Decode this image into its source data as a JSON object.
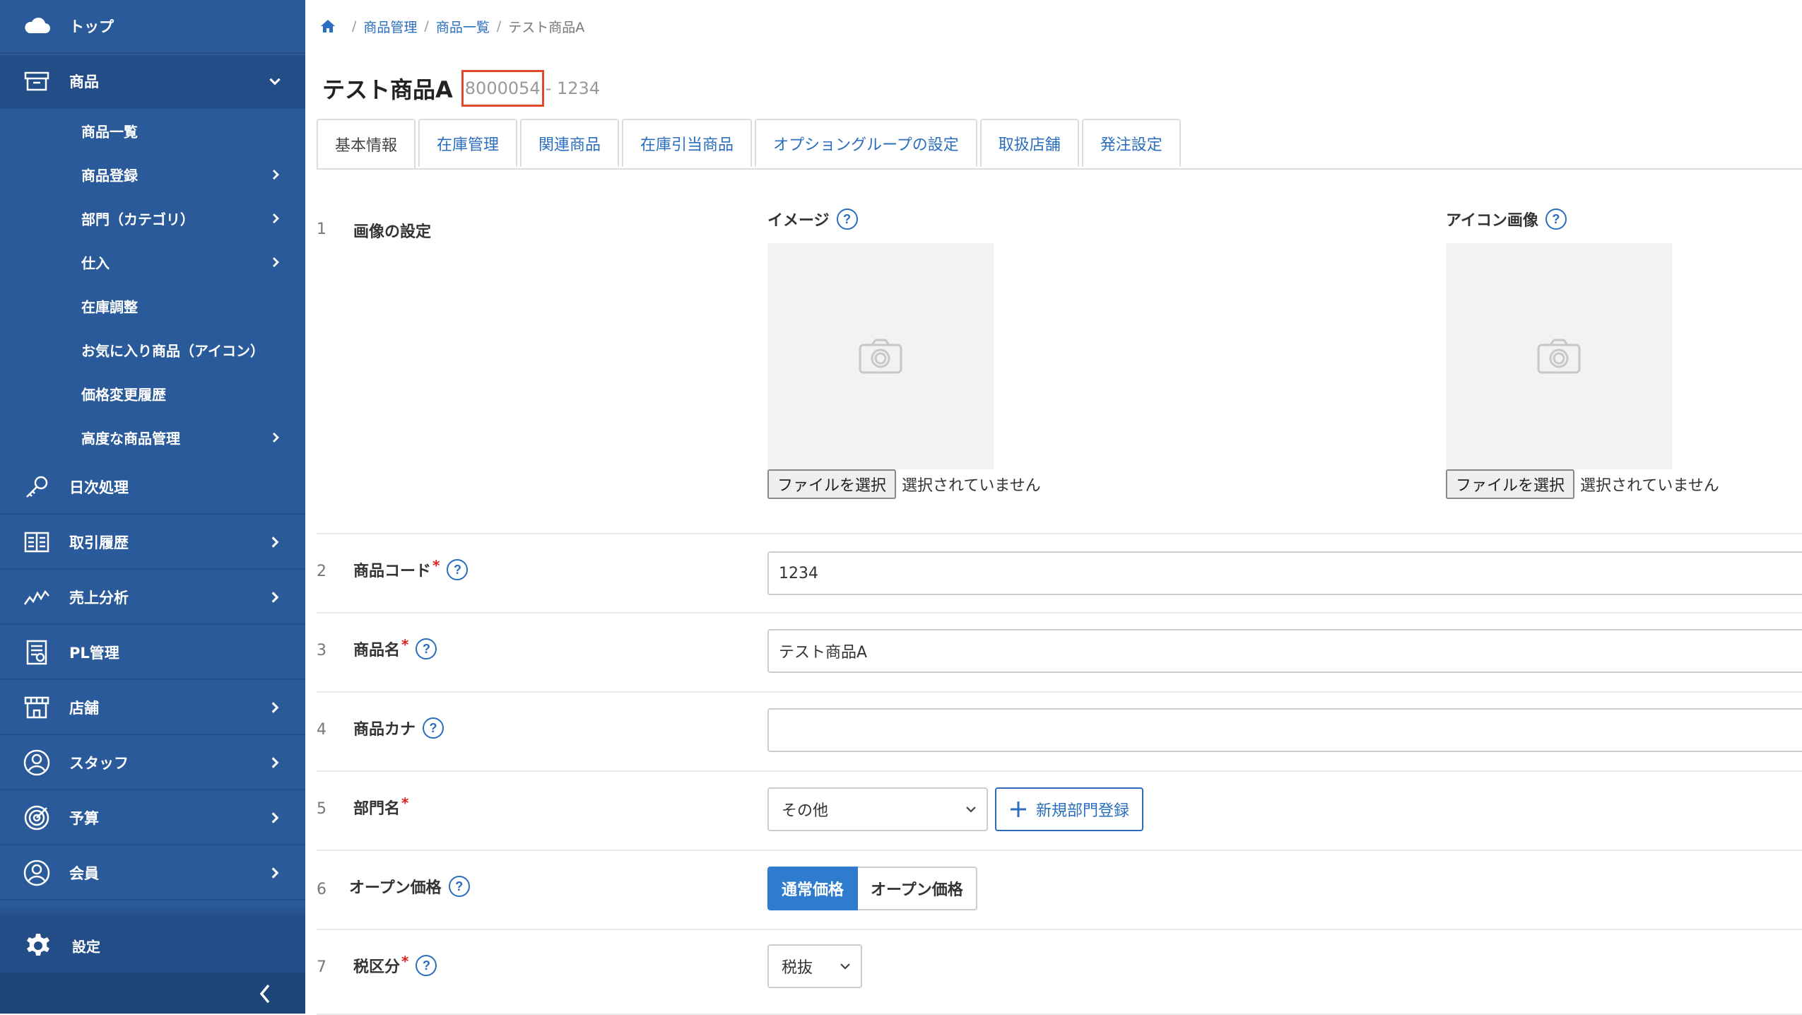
{
  "sidebar": {
    "top": {
      "label": "トップ",
      "icon": "cloud-icon"
    },
    "product": {
      "label": "商品",
      "icon": "box-icon"
    },
    "submenu": [
      {
        "label": "商品一覧",
        "has_children": false
      },
      {
        "label": "商品登録",
        "has_children": true
      },
      {
        "label": "部門（カテゴリ）",
        "has_children": true
      },
      {
        "label": "仕入",
        "has_children": true
      },
      {
        "label": "在庫調整",
        "has_children": false
      },
      {
        "label": "お気に入り商品（アイコン）",
        "has_children": false
      },
      {
        "label": "価格変更履歴",
        "has_children": false
      },
      {
        "label": "高度な商品管理",
        "has_children": true
      }
    ],
    "items": [
      {
        "label": "日次処理",
        "icon": "key-icon",
        "has_children": false
      },
      {
        "label": "取引履歴",
        "icon": "book-icon",
        "has_children": true
      },
      {
        "label": "売上分析",
        "icon": "chart-line-icon",
        "has_children": true
      },
      {
        "label": "PL管理",
        "icon": "report-icon",
        "has_children": false
      },
      {
        "label": "店舗",
        "icon": "store-icon",
        "has_children": true
      },
      {
        "label": "スタッフ",
        "icon": "staff-icon",
        "has_children": true
      },
      {
        "label": "予算",
        "icon": "target-icon",
        "has_children": true
      },
      {
        "label": "会員",
        "icon": "member-icon",
        "has_children": true
      }
    ],
    "settings": {
      "label": "設定",
      "icon": "gear-icon"
    }
  },
  "breadcrumb": {
    "items": [
      "商品管理",
      "商品一覧"
    ],
    "current": "テスト商品A"
  },
  "title": {
    "name": "テスト商品A",
    "sku": "8000054",
    "code": "- 1234"
  },
  "tabs": [
    {
      "label": "基本情報",
      "active": true
    },
    {
      "label": "在庫管理",
      "active": false
    },
    {
      "label": "関連商品",
      "active": false
    },
    {
      "label": "在庫引当商品",
      "active": false
    },
    {
      "label": "オプショングループの設定",
      "active": false
    },
    {
      "label": "取扱店舗",
      "active": false
    },
    {
      "label": "発注設定",
      "active": false
    }
  ],
  "form": {
    "image_row": {
      "num": "1",
      "label": "画像の設定",
      "image": {
        "title": "イメージ",
        "button": "ファイルを選択",
        "status": "選択されていません"
      },
      "icon_image": {
        "title": "アイコン画像",
        "button": "ファイルを選択",
        "status": "選択されていません"
      }
    },
    "product_code": {
      "num": "2",
      "label": "商品コード",
      "value": "1234"
    },
    "product_name": {
      "num": "3",
      "label": "商品名",
      "value": "テスト商品A"
    },
    "product_kana": {
      "num": "4",
      "label": "商品カナ",
      "value": ""
    },
    "department": {
      "num": "5",
      "label": "部門名",
      "selected": "その他",
      "add_button": "新規部門登録"
    },
    "open_price": {
      "num": "6",
      "label": "オープン価格",
      "options": [
        "通常価格",
        "オープン価格"
      ],
      "selected": "通常価格"
    },
    "tax": {
      "num": "7",
      "label": "税区分",
      "selected": "税抜"
    }
  },
  "help_mark": "?",
  "colors": {
    "sidebar": "#2a5a99",
    "accent": "#2a6ebd",
    "toggle_on": "#2f7bd0",
    "highlight_box": "#e04a2c"
  }
}
